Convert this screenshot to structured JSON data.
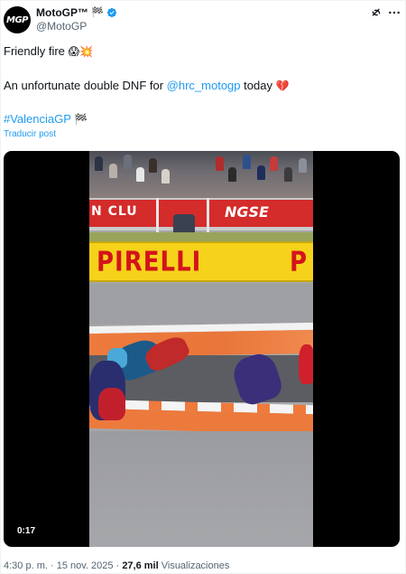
{
  "author": {
    "avatar_label": "MGP",
    "display_name": "MotoGP™",
    "flag": "🏁",
    "handle": "@MotoGP"
  },
  "tweet": {
    "line1_text": "Friendly fire ",
    "line1_emoji": "😱💥",
    "line2_prefix": "An unfortunate double DNF for ",
    "line2_mention": "@hrc_motogp",
    "line2_suffix": " today ",
    "line2_emoji": "💔",
    "hashtag": "#ValenciaGP",
    "hashtag_emoji": "🏁",
    "translate_label": "Traducir post"
  },
  "video": {
    "timestamp": "0:17",
    "board_left_text": "N CLU",
    "board_right_text": "NGSE",
    "sponsor_main": "PIRELLI",
    "sponsor_repeat": "P"
  },
  "meta": {
    "time": "4:30 p. m.",
    "separator": "·",
    "date": "15 nov. 2025",
    "views_count": "27,6 mil",
    "views_label": "Visualizaciones"
  },
  "colors": {
    "link": "#1d9bf0",
    "muted": "#536471",
    "text": "#0f1419",
    "pirelli_yellow": "#f6d21b",
    "pirelli_red": "#d3141b",
    "kerb_orange": "#ec7a3c"
  }
}
